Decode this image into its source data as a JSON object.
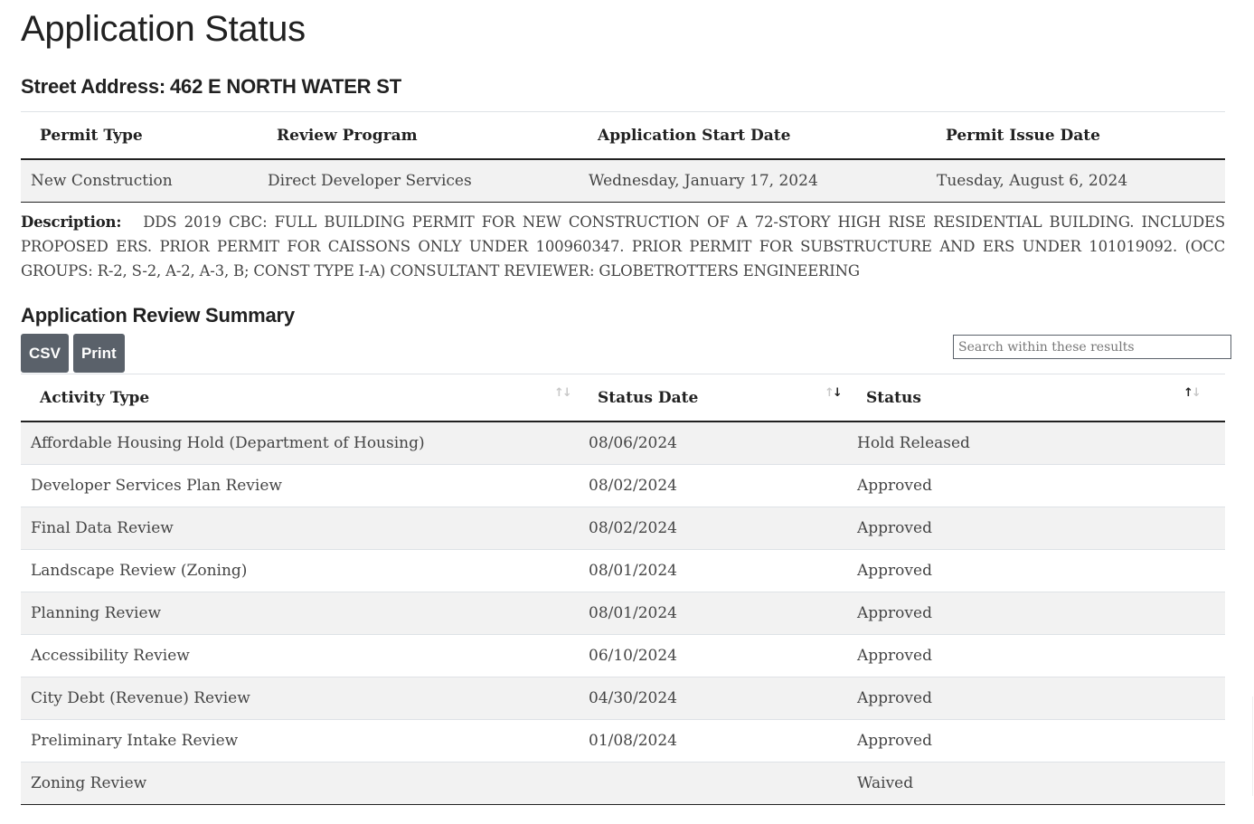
{
  "page": {
    "title": "Application Status",
    "address_label": "Street Address:",
    "address_value": "462 E NORTH WATER ST"
  },
  "permit": {
    "headers": [
      "Permit Type",
      "Review Program",
      "Application Start Date",
      "Permit Issue Date"
    ],
    "values": [
      "New Construction",
      "Direct Developer Services",
      "Wednesday, January 17, 2024",
      "Tuesday, August 6, 2024"
    ]
  },
  "description": {
    "label": "Description:",
    "text": "DDS 2019 CBC: FULL BUILDING PERMIT FOR NEW CONSTRUCTION OF A 72-STORY HIGH RISE RESIDENTIAL BUILDING. INCLUDES PROPOSED ERS. PRIOR PERMIT FOR CAISSONS ONLY UNDER 100960347. PRIOR PERMIT FOR SUBSTRUCTURE AND ERS UNDER 101019092. (OCC GROUPS: R-2, S-2, A-2, A-3, B; CONST TYPE I-A) CONSULTANT REVIEWER: GLOBETROTTERS ENGINEERING"
  },
  "summary": {
    "title": "Application Review Summary",
    "buttons": {
      "csv": "CSV",
      "print": "Print"
    },
    "search_placeholder": "Search within these results",
    "search_value": "",
    "columns": [
      {
        "label": "Activity Type",
        "sort": "none",
        "sort_icon": "sort-arrows-icon"
      },
      {
        "label": "Status Date",
        "sort": "descending",
        "sort_icon": "sort-arrows-icon"
      },
      {
        "label": "Status",
        "sort": "none",
        "sort_icon": "sort-arrows-icon"
      }
    ],
    "sort_glyphs": {
      "up": "↑",
      "down": "↓"
    },
    "rows": [
      {
        "activity": "Affordable Housing Hold (Department of Housing)",
        "date": "08/06/2024",
        "status": "Hold Released"
      },
      {
        "activity": "Developer Services Plan Review",
        "date": "08/02/2024",
        "status": "Approved"
      },
      {
        "activity": "Final Data Review",
        "date": "08/02/2024",
        "status": "Approved"
      },
      {
        "activity": "Landscape Review (Zoning)",
        "date": "08/01/2024",
        "status": "Approved"
      },
      {
        "activity": "Planning Review",
        "date": "08/01/2024",
        "status": "Approved"
      },
      {
        "activity": "Accessibility Review",
        "date": "06/10/2024",
        "status": "Approved"
      },
      {
        "activity": "City Debt (Revenue) Review",
        "date": "04/30/2024",
        "status": "Approved"
      },
      {
        "activity": "Preliminary Intake Review",
        "date": "01/08/2024",
        "status": "Approved"
      },
      {
        "activity": "Zoning Review",
        "date": "",
        "status": "Waived"
      }
    ]
  }
}
